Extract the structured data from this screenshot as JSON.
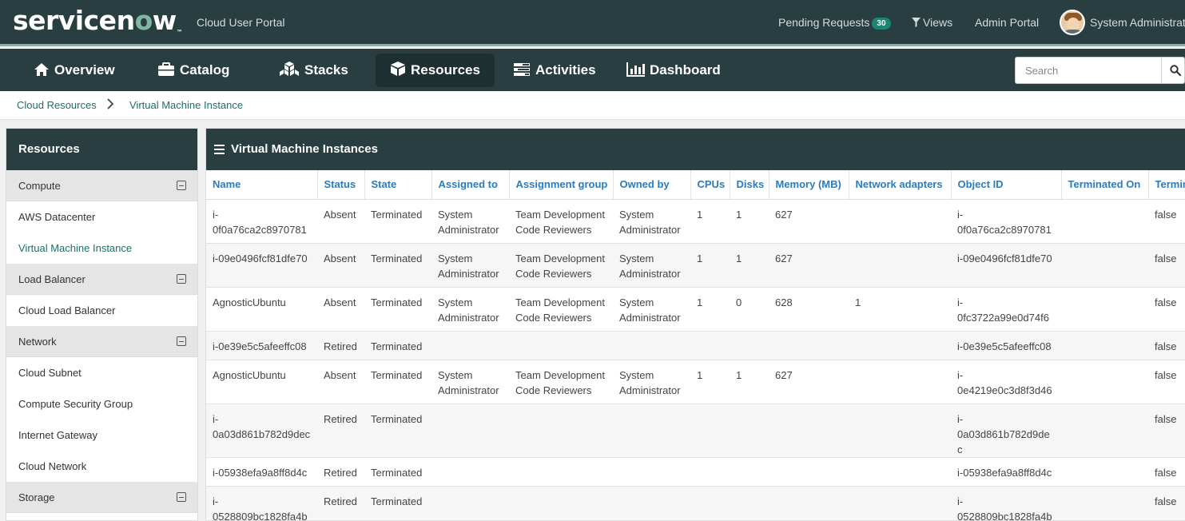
{
  "header": {
    "logo_text_a": "servicen",
    "logo_text_o": "o",
    "logo_text_b": "w",
    "logo_tm": "™",
    "portal_title": "Cloud User Portal",
    "pending_label": "Pending Requests",
    "pending_count": "30",
    "views_label": "Views",
    "admin_portal_label": "Admin Portal",
    "user_name": "System Administrator"
  },
  "nav": {
    "items": [
      {
        "label": "Overview",
        "icon": "home-icon"
      },
      {
        "label": "Catalog",
        "icon": "briefcase-icon"
      },
      {
        "label": "Stacks",
        "icon": "cubes-icon"
      },
      {
        "label": "Resources",
        "icon": "cube-icon"
      },
      {
        "label": "Activities",
        "icon": "tasks-icon"
      },
      {
        "label": "Dashboard",
        "icon": "bar-chart-icon"
      }
    ],
    "active": "Resources",
    "search_placeholder": "Search"
  },
  "breadcrumb": {
    "items": [
      "Cloud Resources",
      "Virtual Machine Instance"
    ]
  },
  "sidebar": {
    "title": "Resources",
    "groups": [
      {
        "label": "Compute",
        "items": [
          "AWS Datacenter",
          "Virtual Machine Instance"
        ]
      },
      {
        "label": "Load Balancer",
        "items": [
          "Cloud Load Balancer"
        ]
      },
      {
        "label": "Network",
        "items": [
          "Cloud Subnet",
          "Compute Security Group",
          "Internet Gateway",
          "Cloud Network"
        ]
      },
      {
        "label": "Storage",
        "items": []
      }
    ],
    "active_item": "Virtual Machine Instance"
  },
  "main": {
    "title": "Virtual Machine Instances",
    "columns": [
      "Name",
      "Status",
      "State",
      "Assigned to",
      "Assignment group",
      "Owned by",
      "CPUs",
      "Disks",
      "Memory (MB)",
      "Network adapters",
      "Object ID",
      "Terminated On",
      "Terminated"
    ],
    "rows": [
      [
        "i-0f0a76ca2c8970781",
        "Absent",
        "Terminated",
        "System Administrator",
        "Team Development Code Reviewers",
        "System Administrator",
        "1",
        "1",
        "627",
        "",
        "i-0f0a76ca2c8970781",
        "",
        "false"
      ],
      [
        "i-09e0496fcf81dfe70",
        "Absent",
        "Terminated",
        "System Administrator",
        "Team Development Code Reviewers",
        "System Administrator",
        "1",
        "1",
        "627",
        "",
        "i-09e0496fcf81dfe70",
        "",
        "false"
      ],
      [
        "AgnosticUbuntu",
        "Absent",
        "Terminated",
        "System Administrator",
        "Team Development Code Reviewers",
        "System Administrator",
        "1",
        "0",
        "628",
        "1",
        "i-0fc3722a99e0d74f6",
        "",
        "false"
      ],
      [
        "i-0e39e5c5afeeffc08",
        "Retired",
        "Terminated",
        "",
        "",
        "",
        "",
        "",
        "",
        "",
        "i-0e39e5c5afeeffc08",
        "",
        "false"
      ],
      [
        "AgnosticUbuntu",
        "Absent",
        "Terminated",
        "System Administrator",
        "Team Development Code Reviewers",
        "System Administrator",
        "1",
        "1",
        "627",
        "",
        "i-0e4219e0c3d8f3d46",
        "",
        "false"
      ],
      [
        "i-0a03d861b782d9dec",
        "Retired",
        "Terminated",
        "",
        "",
        "",
        "",
        "",
        "",
        "",
        "i-0a03d861b782d9dec",
        "",
        "false"
      ],
      [
        "i-05938efa9a8ff8d4c",
        "Retired",
        "Terminated",
        "",
        "",
        "",
        "",
        "",
        "",
        "",
        "i-05938efa9a8ff8d4c",
        "",
        "false"
      ],
      [
        "i-0528809bc1828fa4b",
        "Retired",
        "Terminated",
        "",
        "",
        "",
        "",
        "",
        "",
        "",
        "i-0528809bc1828fa4b",
        "",
        "false"
      ]
    ]
  },
  "colors": {
    "header_bg": "#293e40",
    "accent": "#81b5a1",
    "link": "#2c7bbd",
    "breadcrumb_link": "#1f6f68"
  }
}
